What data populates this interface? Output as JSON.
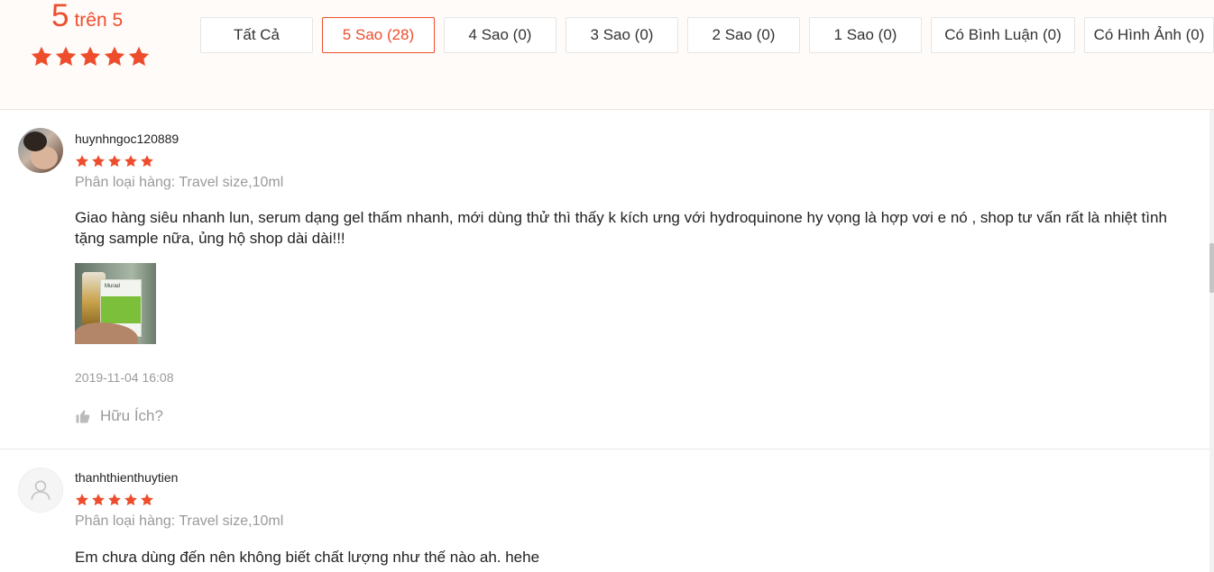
{
  "summary": {
    "score": "5",
    "score_suffix": "trên 5",
    "rating_value": 5,
    "accent_color": "#ee4d2d"
  },
  "filters": [
    {
      "label": "Tất Cả",
      "active": false
    },
    {
      "label": "5 Sao (28)",
      "active": true
    },
    {
      "label": "4 Sao (0)",
      "active": false
    },
    {
      "label": "3 Sao (0)",
      "active": false
    },
    {
      "label": "2 Sao (0)",
      "active": false
    },
    {
      "label": "1 Sao (0)",
      "active": false
    },
    {
      "label": "Có Bình Luận (0)",
      "active": false
    },
    {
      "label": "Có Hình Ảnh (0)",
      "active": false
    }
  ],
  "reviews": [
    {
      "username": "huynhngoc120889",
      "rating": 5,
      "variation": "Phân loại hàng: Travel size,10ml",
      "comment_line1": "Giao hàng siêu nhanh lun, serum dạng gel thấm nhanh, mới dùng thử thì thấy k kích ưng với hydroquinone hy vọng là hợp vơi e nó , shop tư vấn rất là nhiệt tình",
      "comment_line2": "tặng sample nữa, ủng hộ shop dài dài!!!",
      "image_logo": "Murad",
      "time": "2019-11-04 16:08",
      "helpful_label": "Hữu Ích?"
    },
    {
      "username": "thanhthienthuytien",
      "rating": 5,
      "variation": "Phân loại hàng: Travel size,10ml",
      "comment_line1": "Em chưa dùng đến nên không biết chất lượng như thế nào ah. hehe"
    }
  ],
  "icons": {
    "star": "star-icon",
    "helpful": "thumbs-up-icon",
    "avatar_placeholder": "user-icon"
  }
}
